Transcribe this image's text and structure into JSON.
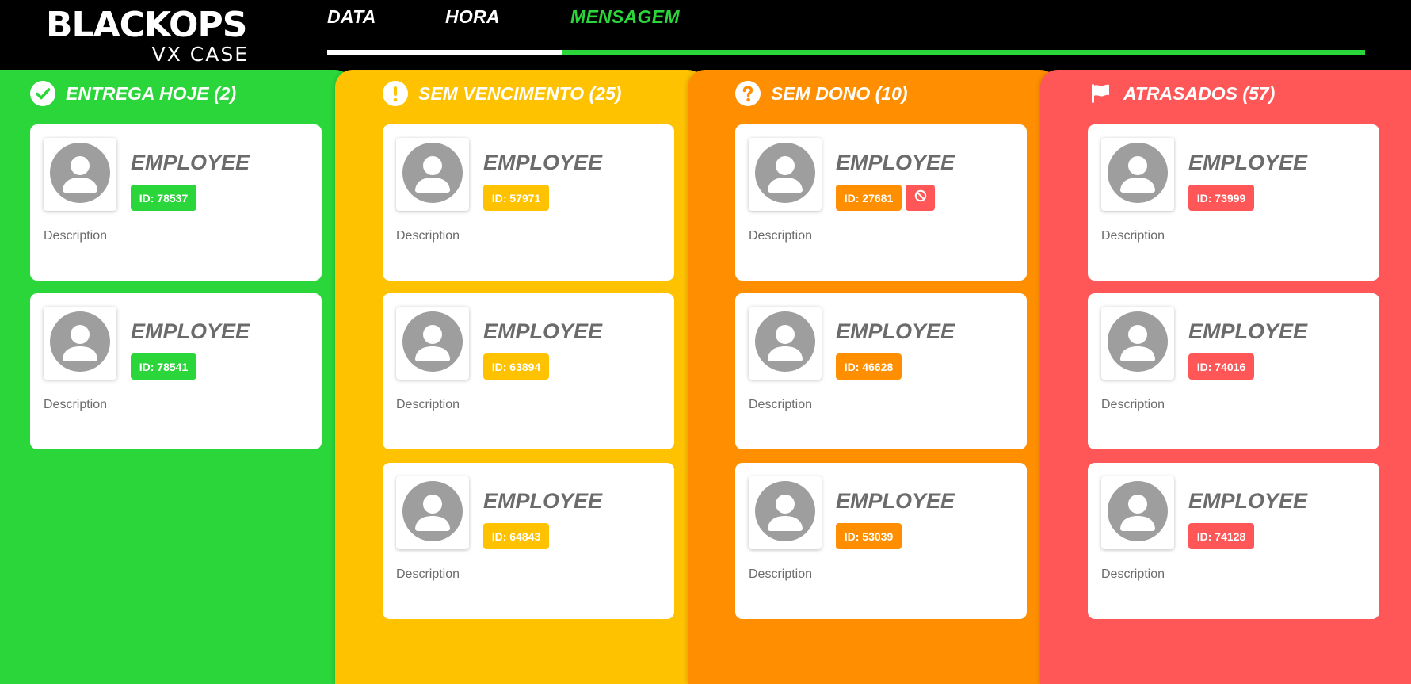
{
  "brand": {
    "name": "BLACKOPS",
    "tagline": "VX CASE"
  },
  "nav": {
    "tabs": [
      {
        "label": "DATA",
        "active": false
      },
      {
        "label": "HORA",
        "active": false
      },
      {
        "label": "MENSAGEM",
        "active": true
      }
    ],
    "progress": 0.227
  },
  "colors": {
    "green": "#2bd63a",
    "yellow": "#ffc200",
    "orange": "#ff8f00",
    "red": "#ff5757",
    "card_text": "#6b6b6b"
  },
  "columns": [
    {
      "title": "ENTREGA HOJE (2)",
      "icon": "check-circle-icon",
      "color": "#2bd63a",
      "cards": [
        {
          "name": "EMPLOYEE",
          "id": "ID: 78537",
          "description": "Description",
          "blocked": false
        },
        {
          "name": "EMPLOYEE",
          "id": "ID: 78541",
          "description": "Description",
          "blocked": false
        }
      ]
    },
    {
      "title": "SEM VENCIMENTO (25)",
      "icon": "exclamation-circle-icon",
      "color": "#ffc200",
      "cards": [
        {
          "name": "EMPLOYEE",
          "id": "ID: 57971",
          "description": "Description",
          "blocked": false
        },
        {
          "name": "EMPLOYEE",
          "id": "ID: 63894",
          "description": "Description",
          "blocked": false
        },
        {
          "name": "EMPLOYEE",
          "id": "ID: 64843",
          "description": "Description",
          "blocked": false
        }
      ]
    },
    {
      "title": "SEM DONO (10)",
      "icon": "question-circle-icon",
      "color": "#ff8f00",
      "cards": [
        {
          "name": "EMPLOYEE",
          "id": "ID: 27681",
          "description": "Description",
          "blocked": true
        },
        {
          "name": "EMPLOYEE",
          "id": "ID: 46628",
          "description": "Description",
          "blocked": false
        },
        {
          "name": "EMPLOYEE",
          "id": "ID: 53039",
          "description": "Description",
          "blocked": false
        }
      ]
    },
    {
      "title": "ATRASADOS (57)",
      "icon": "flag-icon",
      "color": "#ff5757",
      "cards": [
        {
          "name": "EMPLOYEE",
          "id": "ID: 73999",
          "description": "Description",
          "blocked": false
        },
        {
          "name": "EMPLOYEE",
          "id": "ID: 74016",
          "description": "Description",
          "blocked": false
        },
        {
          "name": "EMPLOYEE",
          "id": "ID: 74128",
          "description": "Description",
          "blocked": false
        }
      ]
    }
  ],
  "blocked_badge_color": "#ff5757",
  "avatar_icon": "user-avatar-icon"
}
